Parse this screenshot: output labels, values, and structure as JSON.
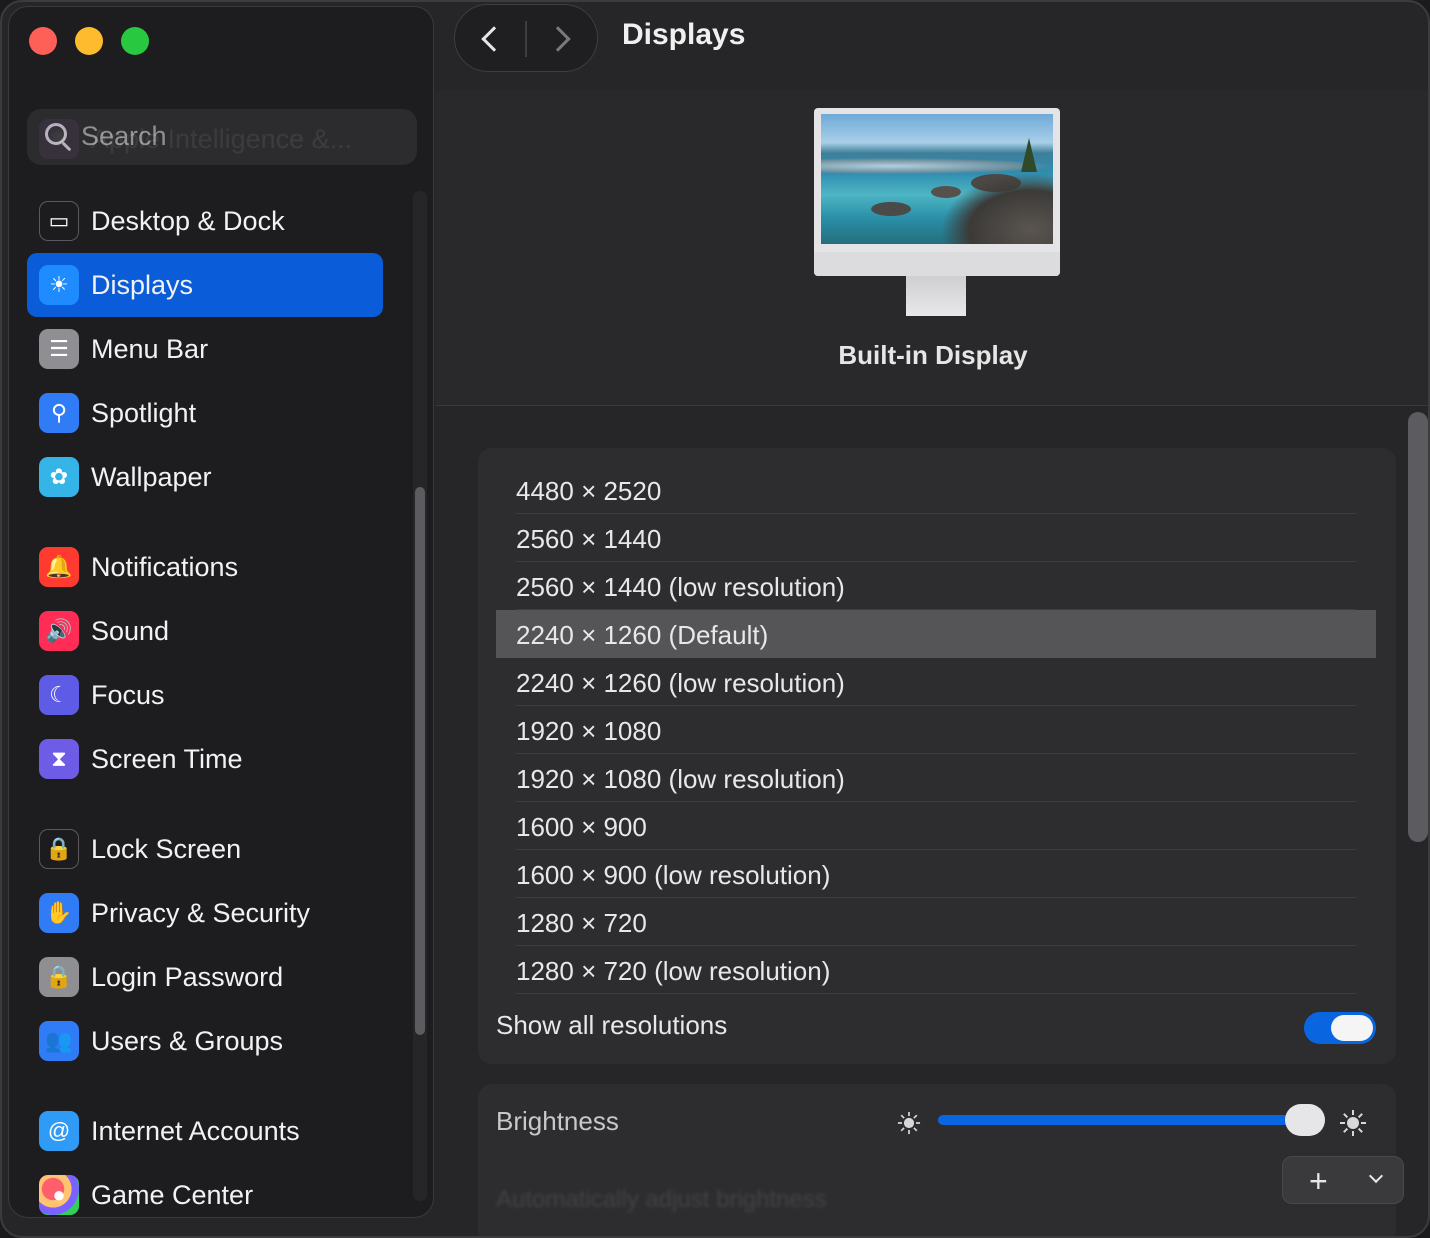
{
  "window": {
    "title": "Displays",
    "nav_back_icon": "chevron-left-icon",
    "nav_forward_icon": "chevron-right-icon"
  },
  "sidebar": {
    "search_placeholder": "Search",
    "items": [
      {
        "label": "Apple Intelligence &...",
        "icon": "apple-intelligence-icon",
        "color": "#b55fd8"
      },
      {
        "label": "Desktop & Dock",
        "icon": "desktop-dock-icon",
        "color": "#1c1c1e"
      },
      {
        "label": "Displays",
        "icon": "displays-sun-icon",
        "color": "#1e8bff",
        "active": true
      },
      {
        "label": "Menu Bar",
        "icon": "menu-bar-icon",
        "color": "#8e8e93"
      },
      {
        "label": "Spotlight",
        "icon": "spotlight-magnifier-icon",
        "color": "#2f7cf6"
      },
      {
        "label": "Wallpaper",
        "icon": "wallpaper-flower-icon",
        "color": "#35b4e8"
      },
      {
        "label": "Notifications",
        "icon": "notifications-bell-icon",
        "color": "#ff3b30"
      },
      {
        "label": "Sound",
        "icon": "sound-speaker-icon",
        "color": "#ff2d55"
      },
      {
        "label": "Focus",
        "icon": "focus-moon-icon",
        "color": "#5e5ce6"
      },
      {
        "label": "Screen Time",
        "icon": "screen-time-hourglass-icon",
        "color": "#6e5ce6"
      },
      {
        "label": "Lock Screen",
        "icon": "lock-screen-icon",
        "color": "#1c1c1e"
      },
      {
        "label": "Privacy & Security",
        "icon": "privacy-hand-icon",
        "color": "#2f7cf6"
      },
      {
        "label": "Login Password",
        "icon": "login-password-lock-icon",
        "color": "#8e8e93"
      },
      {
        "label": "Users & Groups",
        "icon": "users-groups-icon",
        "color": "#2f7cf6"
      },
      {
        "label": "Internet Accounts",
        "icon": "internet-accounts-at-icon",
        "color": "#2f9bf6"
      },
      {
        "label": "Game Center",
        "icon": "game-center-icon",
        "color": "#ffffff"
      }
    ]
  },
  "display": {
    "name": "Built-in Display"
  },
  "resolutions": {
    "items": [
      "4480 × 2520",
      "2560 × 1440",
      "2560 × 1440 (low resolution)",
      "2240 × 1260 (Default)",
      "2240 × 1260 (low resolution)",
      "1920 × 1080",
      "1920 × 1080 (low resolution)",
      "1600 × 900",
      "1600 × 900 (low resolution)",
      "1280 × 720",
      "1280 × 720 (low resolution)"
    ],
    "selected": "2240 × 1260 (Default)",
    "show_all_label": "Show all resolutions",
    "show_all_on": true
  },
  "brightness": {
    "label": "Brightness",
    "level": 0.95,
    "auto_label": "Automatically adjust brightness"
  },
  "add_button": {
    "plus": "+",
    "chevron": "chevron-down-icon"
  },
  "colors": {
    "accent": "#0a66e0",
    "sidebar_active": "#0a5cd8"
  }
}
